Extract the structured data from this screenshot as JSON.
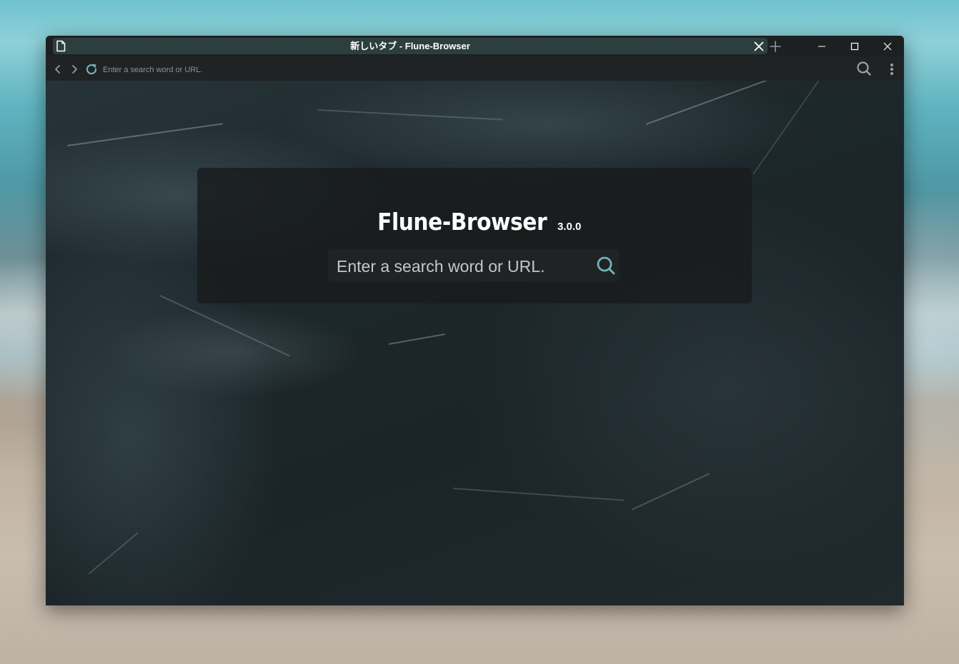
{
  "window": {
    "tab_title": "新しいタブ - Flune-Browser"
  },
  "toolbar": {
    "address_placeholder": "Enter a search word or URL."
  },
  "newtab": {
    "brand_name": "Flune-Browser",
    "version": "3.0.0",
    "search_placeholder": "Enter a search word or URL."
  },
  "icons": {
    "tab": "document-icon",
    "tab_close": "close-icon",
    "new_tab": "plus-icon",
    "minimize": "minimize-icon",
    "maximize": "maximize-icon",
    "close": "close-icon",
    "back": "chevron-left-icon",
    "forward": "chevron-right-icon",
    "reload": "reload-icon",
    "search": "search-icon",
    "menu": "kebab-menu-icon"
  },
  "colors": {
    "accent": "#6fb5b8",
    "tab_bg": "#2d3e3f",
    "chrome_bg": "#202324"
  }
}
